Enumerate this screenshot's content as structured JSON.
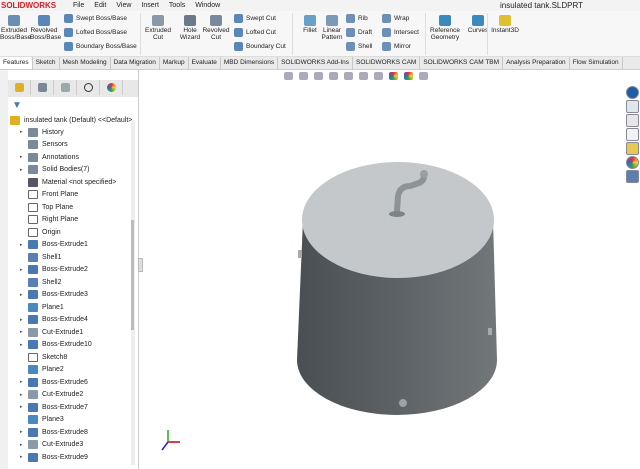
{
  "app": {
    "brand": "SOLIDWORKS",
    "title": "insulated tank.SLDPRT"
  },
  "menu": [
    "File",
    "Edit",
    "View",
    "Insert",
    "Tools",
    "Window"
  ],
  "ribbon": {
    "big": [
      {
        "label": "Extruded Boss/Base",
        "icon": "extruded-boss-icon"
      },
      {
        "label": "Revolved Boss/Base",
        "icon": "revolved-boss-icon"
      },
      {
        "label": "Extruded Cut",
        "icon": "extruded-cut-icon"
      },
      {
        "label": "Hole Wizard",
        "icon": "hole-wizard-icon"
      },
      {
        "label": "Revolved Cut",
        "icon": "revolved-cut-icon"
      },
      {
        "label": "Fillet",
        "icon": "fillet-icon"
      },
      {
        "label": "Linear Pattern",
        "icon": "linear-pattern-icon"
      },
      {
        "label": "Reference Geometry",
        "icon": "reference-geometry-icon"
      },
      {
        "label": "Curves",
        "icon": "curves-icon"
      },
      {
        "label": "Instant3D",
        "icon": "instant3d-icon"
      }
    ],
    "small": [
      {
        "label": "Swept Boss/Base"
      },
      {
        "label": "Lofted Boss/Base"
      },
      {
        "label": "Boundary Boss/Base"
      },
      {
        "label": "Swept Cut"
      },
      {
        "label": "Lofted Cut"
      },
      {
        "label": "Boundary Cut"
      },
      {
        "label": "Rib"
      },
      {
        "label": "Draft"
      },
      {
        "label": "Shell"
      },
      {
        "label": "Wrap"
      },
      {
        "label": "Intersect"
      },
      {
        "label": "Mirror"
      }
    ]
  },
  "tabs": [
    "Features",
    "Sketch",
    "Mesh Modeling",
    "Data Migration",
    "Markup",
    "Evaluate",
    "MBD Dimensions",
    "SOLIDWORKS Add-Ins",
    "SOLIDWORKS CAM",
    "SOLIDWORKS CAM TBM",
    "Analysis Preparation",
    "Flow Simulation"
  ],
  "active_tab": "Features",
  "tree": {
    "root": "insulated tank (Default) <<Default>",
    "items": [
      {
        "label": "History",
        "expand": true,
        "type": "folder"
      },
      {
        "label": "Sensors",
        "expand": false,
        "type": "folder"
      },
      {
        "label": "Annotations",
        "expand": true,
        "type": "folder"
      },
      {
        "label": "Solid Bodies(7)",
        "expand": true,
        "type": "folder"
      },
      {
        "label": "Material <not specified>",
        "expand": false,
        "type": "material"
      },
      {
        "label": "Front Plane",
        "expand": false,
        "type": "plane"
      },
      {
        "label": "Top Plane",
        "expand": false,
        "type": "plane"
      },
      {
        "label": "Right Plane",
        "expand": false,
        "type": "plane"
      },
      {
        "label": "Origin",
        "expand": false,
        "type": "origin"
      },
      {
        "label": "Boss-Extrude1",
        "expand": true,
        "type": "boss"
      },
      {
        "label": "Shell1",
        "expand": false,
        "type": "shell"
      },
      {
        "label": "Boss-Extrude2",
        "expand": true,
        "type": "boss"
      },
      {
        "label": "Shell2",
        "expand": false,
        "type": "shell"
      },
      {
        "label": "Boss-Extrude3",
        "expand": true,
        "type": "boss"
      },
      {
        "label": "Plane1",
        "expand": false,
        "type": "refplane"
      },
      {
        "label": "Boss-Extrude4",
        "expand": true,
        "type": "boss"
      },
      {
        "label": "Cut-Extrude1",
        "expand": true,
        "type": "cut"
      },
      {
        "label": "Boss-Extrude10",
        "expand": true,
        "type": "boss"
      },
      {
        "label": "Sketch8",
        "expand": false,
        "type": "sketch"
      },
      {
        "label": "Plane2",
        "expand": false,
        "type": "refplane"
      },
      {
        "label": "Boss-Extrude6",
        "expand": true,
        "type": "boss"
      },
      {
        "label": "Cut-Extrude2",
        "expand": true,
        "type": "cut"
      },
      {
        "label": "Boss-Extrude7",
        "expand": true,
        "type": "boss"
      },
      {
        "label": "Plane3",
        "expand": false,
        "type": "refplane"
      },
      {
        "label": "Boss-Extrude8",
        "expand": true,
        "type": "boss"
      },
      {
        "label": "Cut-Extrude3",
        "expand": true,
        "type": "cut"
      },
      {
        "label": "Boss-Extrude9",
        "expand": true,
        "type": "boss"
      }
    ]
  },
  "colors": {
    "brand": "#d0202a",
    "tank_body": "#5f6467",
    "tank_top": "#c4c8ca",
    "boss": "#4a78b0",
    "cut": "#8a9aa8"
  }
}
